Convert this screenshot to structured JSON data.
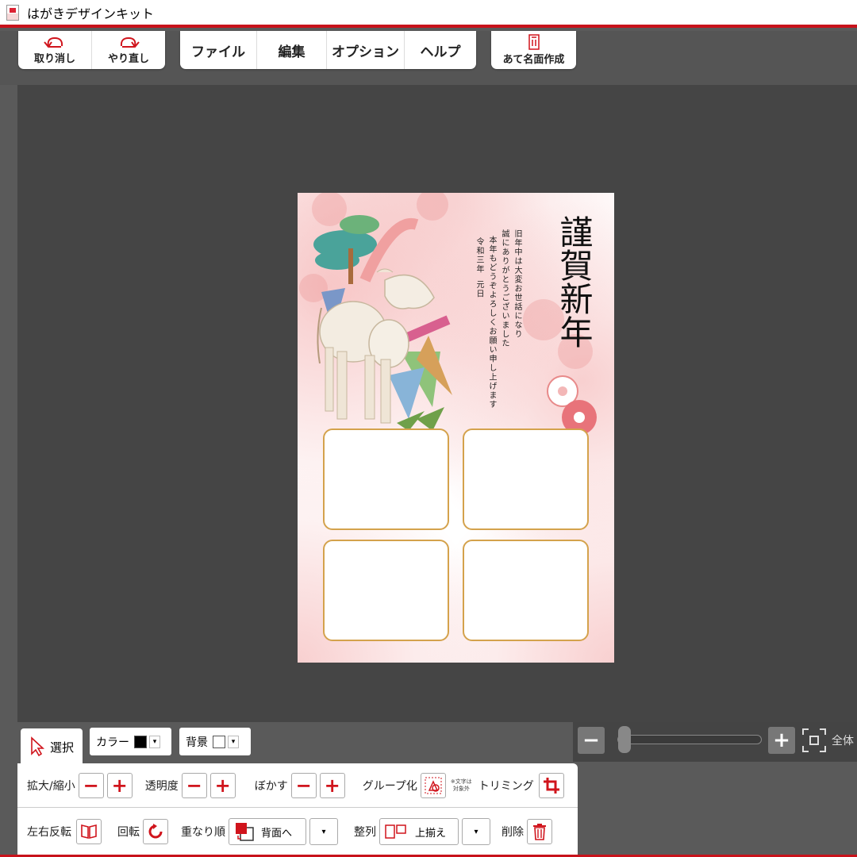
{
  "window": {
    "title": "はがきデザインキット"
  },
  "toolbar": {
    "undo_label": "取り消し",
    "redo_label": "やり直し",
    "menus": [
      "ファイル",
      "編集",
      "オプション",
      "ヘルプ"
    ],
    "address_label": "あて名面作成"
  },
  "postcard": {
    "title": "謹賀新年",
    "message_lines": [
      "旧年中は大変お世話になり",
      "誠にありがとうございました",
      "本年もどうぞよろしくお願い申し上げます"
    ],
    "date_lines": [
      "令和三年",
      "元日"
    ]
  },
  "bottom": {
    "select_tab": "選択",
    "color_label": "カラー",
    "color_value": "#000000",
    "background_label": "背景",
    "background_value": "#ffffff",
    "scale_label": "拡大/縮小",
    "opacity_label": "透明度",
    "blur_label": "ぼかす",
    "group_label": "グループ化",
    "group_note": [
      "※文字は",
      "対象外"
    ],
    "trim_label": "トリミング",
    "flip_label": "左右反転",
    "rotate_label": "回転",
    "order_label": "重なり順",
    "order_value": "背面へ",
    "align_label": "整列",
    "align_value": "上揃え",
    "delete_label": "削除"
  },
  "zoom": {
    "fit_label": "全体"
  },
  "colors": {
    "accent": "#c8121b",
    "frame_gold": "#d4a24c"
  }
}
